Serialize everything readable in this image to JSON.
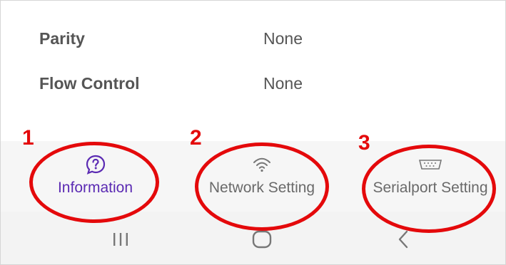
{
  "settings": {
    "rows": [
      {
        "label": "Parity",
        "value": "None"
      },
      {
        "label": "Flow Control",
        "value": "None"
      }
    ]
  },
  "bottom_nav": {
    "tabs": [
      {
        "label": "Information",
        "icon": "help-chat-icon",
        "active": true,
        "color": "#5b2bb3"
      },
      {
        "label": "Network Setting",
        "icon": "wifi-icon",
        "active": false,
        "color": "#6a6a6a"
      },
      {
        "label": "Serialport Setting",
        "icon": "serial-port-icon",
        "active": false,
        "color": "#6a6a6a"
      }
    ]
  },
  "system_nav": {
    "buttons": [
      "recents-icon",
      "home-icon",
      "back-icon"
    ]
  },
  "annotations": {
    "color": "#e4090b",
    "numbers": [
      "1",
      "2",
      "3"
    ]
  }
}
